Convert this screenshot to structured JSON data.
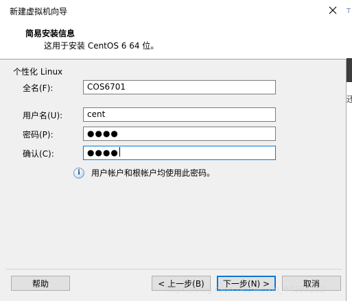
{
  "window": {
    "title": "新建虚拟机向导",
    "close_glyph": "✕"
  },
  "header": {
    "title": "简易安装信息",
    "subtitle": "这用于安装 CentOS 6 64 位。"
  },
  "group": {
    "label": "个性化 Linux"
  },
  "fields": {
    "fullname": {
      "label": "全名(F):",
      "value": "COS6701"
    },
    "username": {
      "label": "用户名(U):",
      "value": "cent"
    },
    "password": {
      "label": "密码(P):",
      "value": "●●●●"
    },
    "confirm": {
      "label": "确认(C):",
      "value": "●●●●"
    }
  },
  "info": {
    "icon": "info-icon",
    "glyph": "i",
    "text": "用户帐户和根帐户均使用此密码。"
  },
  "buttons": {
    "help": "帮助",
    "back": "< 上一步(B)",
    "next": "下一步(N) >",
    "cancel": "取消"
  },
  "background": {
    "t_glyph": "T",
    "char": "还"
  },
  "watermark": "https://blog.csdn.net/weixin_44193212",
  "colors": {
    "focus_border": "#0078d7",
    "dialog_bg": "#f0f0f0"
  }
}
